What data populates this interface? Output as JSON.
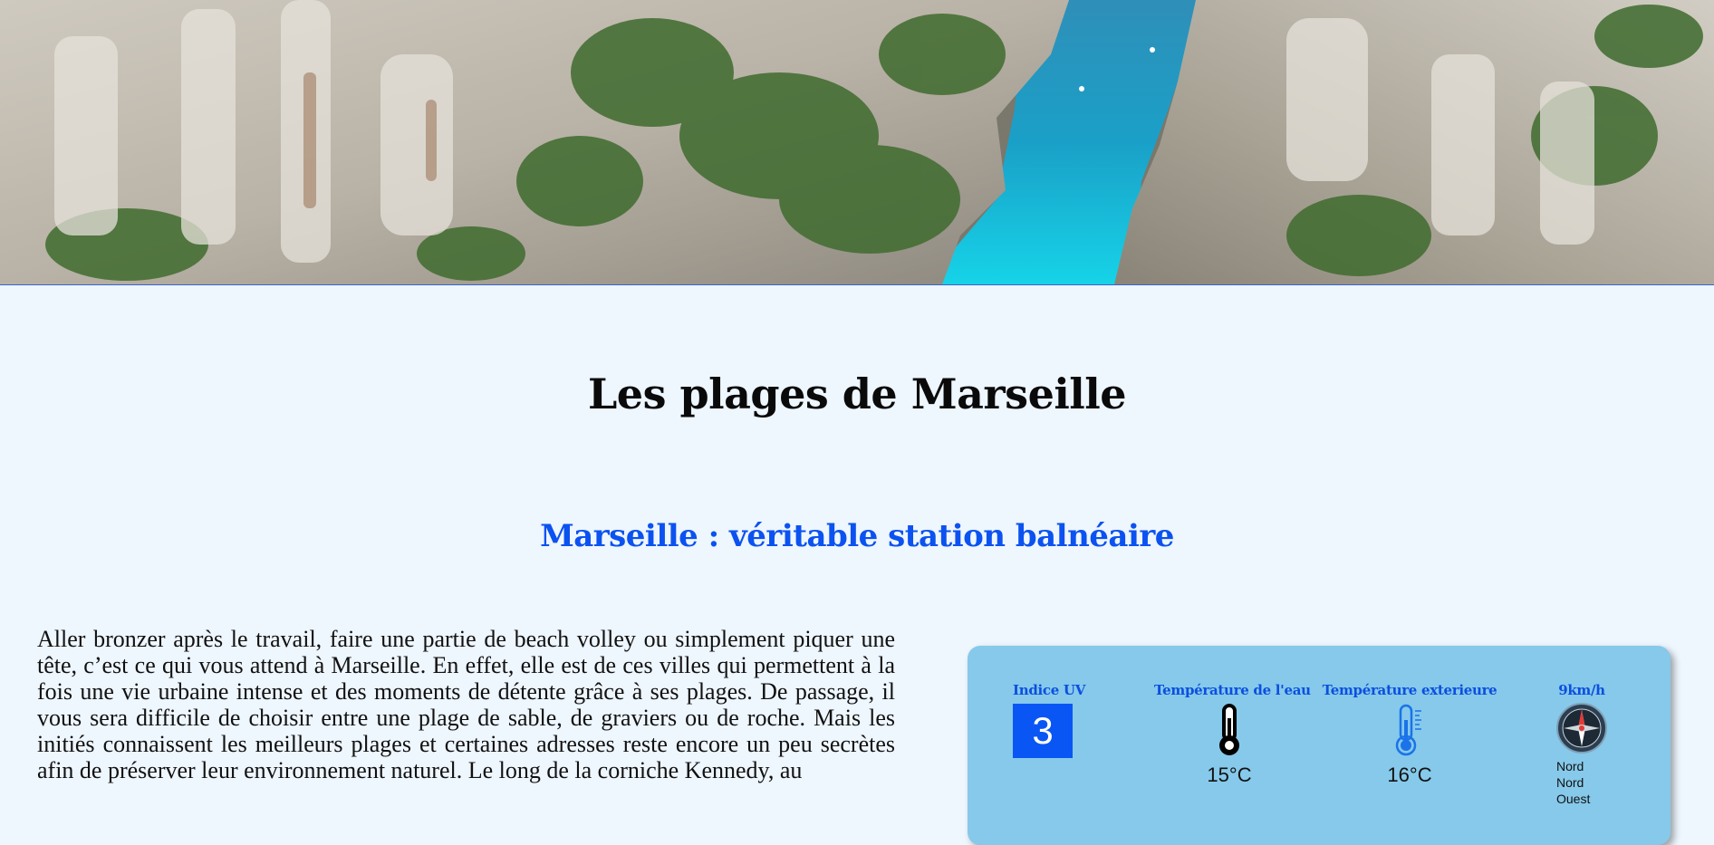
{
  "hero": {
    "image_icon": "calanque-landscape-photo"
  },
  "page_title": "Les plages de Marseille",
  "section_title": "Marseille : véritable station balnéaire",
  "intro_text": "Aller bronzer après le travail, faire une partie de beach volley ou simplement piquer une tête, c’est ce qui vous attend à Marseille. En effet, elle est de ces villes qui permettent à la fois une vie urbaine intense et des moments de détente grâce à ses plages. De passage, il vous sera difficile de choisir entre une plage de sable, de graviers ou de roche. Mais les initiés connaissent les meilleurs plages et certaines adresses reste encore un peu secrètes afin de préserver leur environnement naturel. Le long de la corniche Kennedy, au",
  "weather": {
    "uv": {
      "label": "Indice UV",
      "value": "3",
      "color": "#0a56f5"
    },
    "water": {
      "label": "Température de l'eau",
      "value": "15°C",
      "icon": "thermometer-icon"
    },
    "air": {
      "label": "Température exterieure",
      "value": "16°C",
      "icon": "thermometer-icon"
    },
    "wind": {
      "label": "9km/h",
      "icon": "compass-icon",
      "dir1": "Nord",
      "dir2": "Nord",
      "dir3": "Ouest"
    }
  },
  "colors": {
    "accent": "#0b52f0",
    "background": "#eef6fe",
    "card": "#86c9ea"
  }
}
